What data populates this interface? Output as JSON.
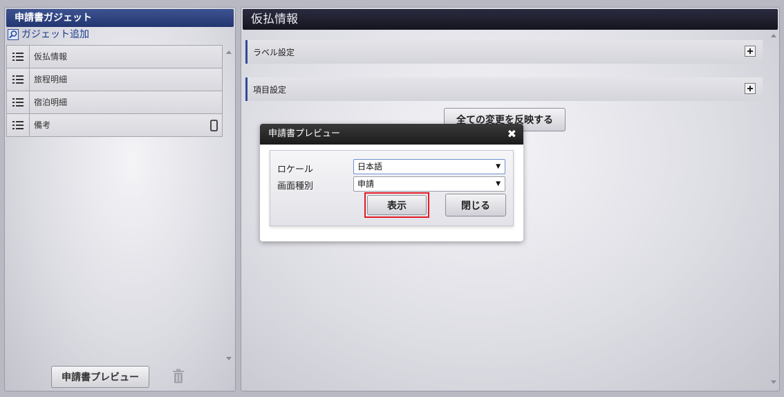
{
  "left": {
    "title": "申請書ガジェット",
    "add_label": "ガジェット追加",
    "items": [
      {
        "label": "仮払情報",
        "mobile": false
      },
      {
        "label": "旅程明細",
        "mobile": false
      },
      {
        "label": "宿泊明細",
        "mobile": false
      },
      {
        "label": "備考",
        "mobile": true
      }
    ],
    "preview_button": "申請書プレビュー"
  },
  "right": {
    "title": "仮払情報",
    "sections": [
      {
        "label": "ラベル設定"
      },
      {
        "label": "項目設定"
      }
    ],
    "apply_all_button": "全ての変更を反映する"
  },
  "dialog": {
    "title": "申請書プレビュー",
    "close_symbol": "✖",
    "locale_label": "ロケール",
    "locale_value": "日本語",
    "screen_type_label": "画面種別",
    "screen_type_value": "申請",
    "show_button": "表示",
    "close_button": "閉じる",
    "select_arrow": "▼"
  },
  "colors": {
    "left_header": "#2d4382",
    "right_header": "#1e1e2c",
    "section_accent": "#2d4c95",
    "highlight": "#e21b26"
  }
}
